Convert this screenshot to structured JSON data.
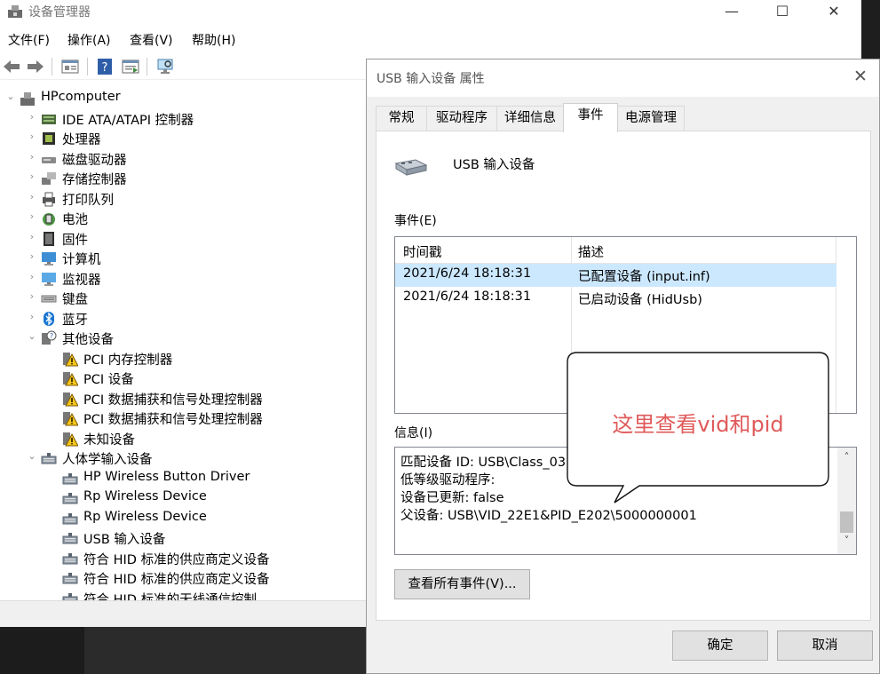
{
  "main_window": {
    "title": "设备管理器",
    "controls": {
      "minimize": "—",
      "maximize": "☐",
      "close": "✕"
    }
  },
  "menu": [
    "文件(F)",
    "操作(A)",
    "查看(V)",
    "帮助(H)"
  ],
  "toolbar": {
    "icons": [
      "back-arrow-icon",
      "forward-arrow-icon",
      "properties-icon",
      "help-icon",
      "update-driver-icon",
      "scan-hardware-icon"
    ]
  },
  "tree": [
    {
      "label": "HPcomputer",
      "level": 0,
      "expander": "⌄",
      "icon": "computer-root-icon"
    },
    {
      "label": "IDE ATA/ATAPI 控制器",
      "level": 1,
      "expander": "›",
      "icon": "ide-controller-icon"
    },
    {
      "label": "处理器",
      "level": 1,
      "expander": "›",
      "icon": "processor-icon"
    },
    {
      "label": "磁盘驱动器",
      "level": 1,
      "expander": "›",
      "icon": "disk-drive-icon"
    },
    {
      "label": "存储控制器",
      "level": 1,
      "expander": "›",
      "icon": "storage-controller-icon"
    },
    {
      "label": "打印队列",
      "level": 1,
      "expander": "›",
      "icon": "printer-icon"
    },
    {
      "label": "电池",
      "level": 1,
      "expander": "›",
      "icon": "battery-icon"
    },
    {
      "label": "固件",
      "level": 1,
      "expander": "›",
      "icon": "firmware-icon"
    },
    {
      "label": "计算机",
      "level": 1,
      "expander": "›",
      "icon": "computer-icon"
    },
    {
      "label": "监视器",
      "level": 1,
      "expander": "›",
      "icon": "monitor-icon"
    },
    {
      "label": "键盘",
      "level": 1,
      "expander": "›",
      "icon": "keyboard-icon"
    },
    {
      "label": "蓝牙",
      "level": 1,
      "expander": "›",
      "icon": "bluetooth-icon"
    },
    {
      "label": "其他设备",
      "level": 1,
      "expander": "⌄",
      "icon": "other-devices-icon"
    },
    {
      "label": "PCI 内存控制器",
      "level": 2,
      "expander": "",
      "icon": "warning-device-icon"
    },
    {
      "label": "PCI 设备",
      "level": 2,
      "expander": "",
      "icon": "warning-device-icon"
    },
    {
      "label": "PCI 数据捕获和信号处理控制器",
      "level": 2,
      "expander": "",
      "icon": "warning-device-icon"
    },
    {
      "label": "PCI 数据捕获和信号处理控制器",
      "level": 2,
      "expander": "",
      "icon": "warning-device-icon"
    },
    {
      "label": "未知设备",
      "level": 2,
      "expander": "",
      "icon": "warning-device-icon"
    },
    {
      "label": "人体学输入设备",
      "level": 1,
      "expander": "⌄",
      "icon": "hid-icon"
    },
    {
      "label": "HP Wireless Button Driver",
      "level": 2,
      "expander": "",
      "icon": "hid-icon"
    },
    {
      "label": "Rp Wireless Device",
      "level": 2,
      "expander": "",
      "icon": "hid-icon"
    },
    {
      "label": "Rp Wireless Device",
      "level": 2,
      "expander": "",
      "icon": "hid-icon"
    },
    {
      "label": "USB 输入设备",
      "level": 2,
      "expander": "",
      "icon": "hid-icon"
    },
    {
      "label": "符合 HID 标准的供应商定义设备",
      "level": 2,
      "expander": "",
      "icon": "hid-icon"
    },
    {
      "label": "符合 HID 标准的供应商定义设备",
      "level": 2,
      "expander": "",
      "icon": "hid-icon"
    },
    {
      "label": "符合 HID 标准的无线通信控制",
      "level": 2,
      "expander": "",
      "icon": "hid-icon"
    }
  ],
  "dialog": {
    "title": "USB 输入设备 属性",
    "close": "✕",
    "tabs": [
      "常规",
      "驱动程序",
      "详细信息",
      "事件",
      "电源管理"
    ],
    "active_tab": "事件",
    "device_name": "USB 输入设备",
    "events_label": "事件(E)",
    "events_columns": [
      "时间戳",
      "描述"
    ],
    "events": [
      {
        "time": "2021/6/24 18:18:31",
        "desc": "已配置设备 (input.inf)"
      },
      {
        "time": "2021/6/24 18:18:31",
        "desc": "已启动设备 (HidUsb)"
      }
    ],
    "info_label": "信息(I)",
    "info_lines": [
      "匹配设备 ID: USB\\Class_03",
      "低等级驱动程序:",
      "设备已更新: false",
      "父设备: USB\\VID_22E1&PID_E202\\5000000001"
    ],
    "scroll": {
      "up": "˄",
      "down": "˅"
    },
    "view_all_button": "查看所有事件(V)...",
    "ok_button": "确定",
    "cancel_button": "取消"
  },
  "callout": {
    "text": "这里查看vid和pid",
    "color": "#e05a5a"
  },
  "colors": {
    "selection": "#cce8ff",
    "dialog_bg": "#f0f0f0",
    "taskbar": "#1c1c1c"
  }
}
